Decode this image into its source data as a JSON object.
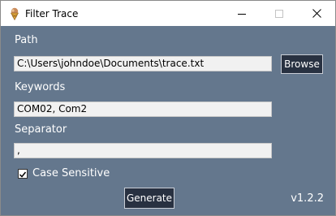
{
  "window": {
    "title": "Filter Trace",
    "icon": "ice-cream-cone-icon"
  },
  "form": {
    "path_label": "Path",
    "path_value": "C:\\Users\\johndoe\\Documents\\trace.txt",
    "browse_label": "Browse",
    "keywords_label": "Keywords",
    "keywords_value": "COM02, Com2",
    "separator_label": "Separator",
    "separator_value": ",",
    "case_sensitive_label": "Case Sensitive",
    "case_sensitive_checked": true,
    "generate_label": "Generate",
    "version": "v1.2.2"
  },
  "colors": {
    "background": "#64778d",
    "button": "#283141",
    "field": "#f1f1f1"
  }
}
